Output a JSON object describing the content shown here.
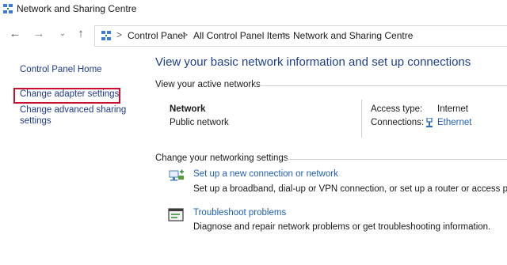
{
  "window": {
    "title": "Network and Sharing Centre"
  },
  "breadcrumb": [
    "Control Panel",
    "All Control Panel Items",
    "Network and Sharing Centre"
  ],
  "nav": {
    "back": "←",
    "forward": "→",
    "recent": "⌄",
    "up": "↑",
    "separator": ">"
  },
  "sidebar": {
    "home": "Control Panel Home",
    "adapter": "Change adapter settings",
    "advanced_line1": "Change advanced sharing",
    "advanced_line2": "settings"
  },
  "main": {
    "title": "View your basic network information and set up connections",
    "active_label": "View your active networks",
    "network": {
      "name": "Network",
      "type": "Public network"
    },
    "access_type_label": "Access type:",
    "access_type_value": "Internet",
    "connections_label": "Connections:",
    "connections_value": "Ethernet",
    "change_label": "Change your networking settings",
    "tasks": [
      {
        "icon": "network-setup-icon",
        "title": "Set up a new connection or network",
        "desc": "Set up a broadband, dial-up or VPN connection, or set up a router or access point."
      },
      {
        "icon": "troubleshoot-icon",
        "title": "Troubleshoot problems",
        "desc": "Diagnose and repair network problems or get troubleshooting information."
      }
    ]
  },
  "colors": {
    "link": "#1e5fb4",
    "title": "#1e3f8a",
    "highlight": "#c8102e"
  }
}
